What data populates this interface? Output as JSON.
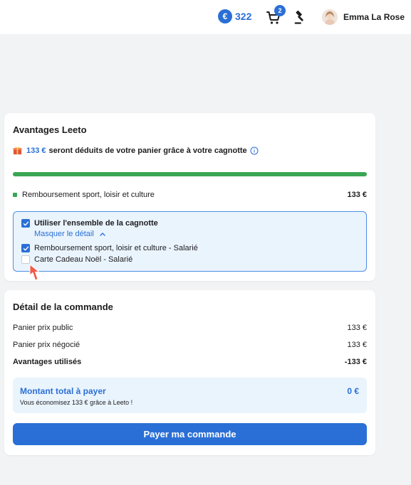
{
  "header": {
    "balance_symbol": "€",
    "balance_value": "322",
    "cart_count": "2",
    "user_name": "Emma La Rose"
  },
  "benefits": {
    "title": "Avantages Leeto",
    "savings_amount": "133 €",
    "savings_text": "seront déduits de votre panier grâce à votre cagnotte",
    "progress": 1.0,
    "legend_label": "Remboursement sport, loisir et culture",
    "legend_amount": "133 €",
    "use_all_label": "Utiliser l'ensemble de la cagnotte",
    "use_all_checked": true,
    "toggle_label": "Masquer le détail",
    "items": [
      {
        "label": "Remboursement sport, loisir et culture - Salarié",
        "checked": true
      },
      {
        "label": "Carte Cadeau Noël - Salarié",
        "checked": false
      }
    ]
  },
  "order": {
    "title": "Détail de la commande",
    "rows": [
      {
        "label": "Panier prix public",
        "value": "133 €"
      },
      {
        "label": "Panier prix négocié",
        "value": "133 €"
      },
      {
        "label": "Avantages utilisés",
        "value": "-133 €"
      }
    ],
    "total_label": "Montant total à payer",
    "total_value": "0 €",
    "total_sub": "Vous économisez 133 € grâce à Leeto !",
    "pay_button": "Payer ma commande"
  },
  "colors": {
    "accent": "#2a6fd6",
    "success": "#3aa655",
    "panel_bg": "#eaf4fd"
  }
}
